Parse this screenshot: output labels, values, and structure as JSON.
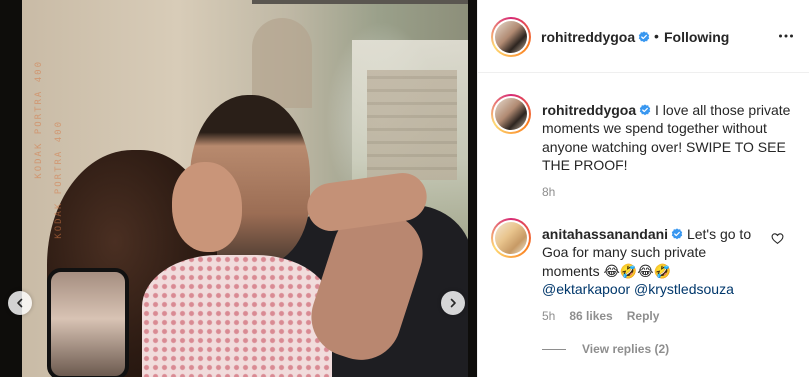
{
  "post": {
    "username": "rohitreddygoa",
    "separator": "•",
    "follow_status": "Following",
    "caption_text": "I love all those private moments we spend together without anyone watching over! SWIPE TO SEE THE PROOF!",
    "caption_time": "8h"
  },
  "comment": {
    "username": "anitahassanandani",
    "text": "Let's go to Goa for many such private moments 😂🤣😂🤣",
    "mentions": [
      "@ektarkapoor",
      "@krystledsouza"
    ],
    "time": "5h",
    "likes": "86 likes",
    "reply_label": "Reply",
    "view_replies": "View replies (2)"
  },
  "photo": {
    "watermark": "KODAK PORTRA 400"
  },
  "icons": {
    "verified": "verified-badge-icon",
    "more": "more-options-icon",
    "heart": "heart-outline-icon",
    "prev": "chevron-left-icon",
    "next": "chevron-right-icon"
  },
  "colors": {
    "verified_blue": "#3897f0",
    "mention_blue": "#00376b",
    "muted_gray": "#8e8e8e",
    "text_dark": "#262626"
  }
}
